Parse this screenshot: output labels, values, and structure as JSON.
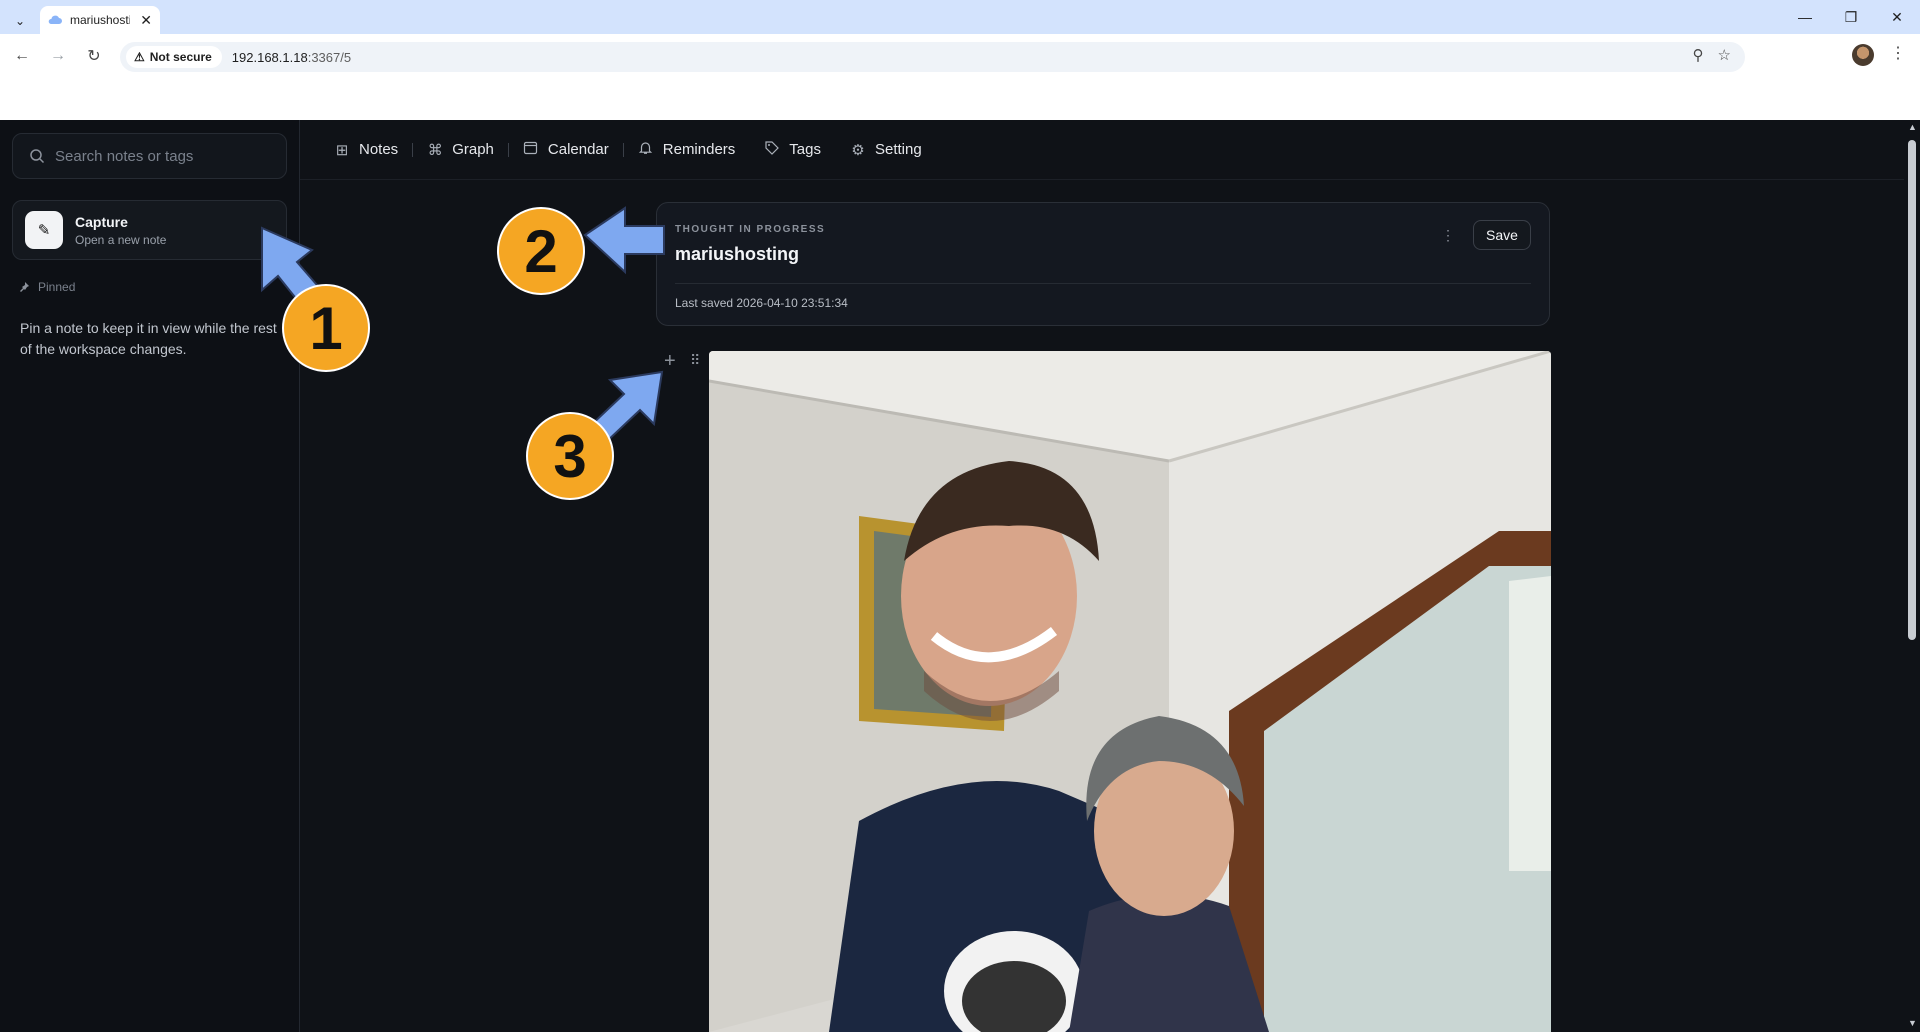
{
  "browser": {
    "tab_title": "mariushosting",
    "security_label": "Not secure",
    "url_host": "192.168.1.18",
    "url_rest": ":3367/5"
  },
  "sidebar": {
    "search_placeholder": "Search notes or tags",
    "capture_title": "Capture",
    "capture_subtitle": "Open a new note",
    "pinned_label": "Pinned",
    "pinned_hint": "Pin a note to keep it in view while the rest of the workspace changes."
  },
  "nav": {
    "items": [
      {
        "label": "Notes",
        "icon": "grid-icon"
      },
      {
        "label": "Graph",
        "icon": "command-icon"
      },
      {
        "label": "Calendar",
        "icon": "calendar-icon"
      },
      {
        "label": "Reminders",
        "icon": "bell-icon"
      },
      {
        "label": "Tags",
        "icon": "tag-icon"
      },
      {
        "label": "Setting",
        "icon": "gear-icon"
      }
    ]
  },
  "note": {
    "eyebrow": "THOUGHT IN PROGRESS",
    "title": "mariushosting",
    "save_label": "Save",
    "last_saved": "Last saved 2026-04-10 23:51:34"
  },
  "annotations": {
    "badge_1": "1",
    "badge_2": "2",
    "badge_3": "3"
  },
  "colors": {
    "app_bg": "#0f1217",
    "badge": "#f5a623",
    "arrow": "#7ea8f0"
  }
}
